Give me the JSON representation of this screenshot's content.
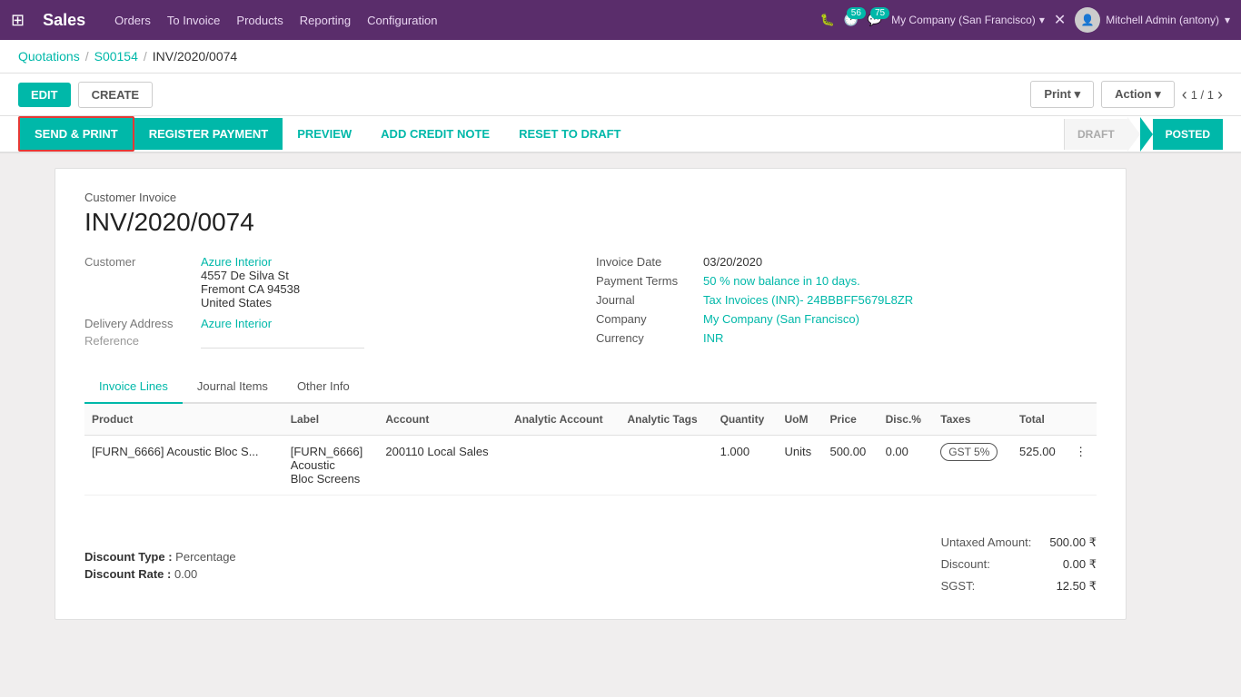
{
  "nav": {
    "brand": "Sales",
    "links": [
      "Orders",
      "To Invoice",
      "Products",
      "Reporting",
      "Configuration"
    ],
    "badge_clock": "56",
    "badge_chat": "75",
    "company": "My Company (San Francisco)",
    "user": "Mitchell Admin (antony)"
  },
  "breadcrumb": {
    "quotations": "Quotations",
    "sale_order": "S00154",
    "invoice": "INV/2020/0074"
  },
  "toolbar": {
    "edit": "EDIT",
    "create": "CREATE",
    "print": "Print",
    "action": "Action",
    "pagination": "1 / 1"
  },
  "secondary_toolbar": {
    "send_print": "SEND & PRINT",
    "register_payment": "REGISTER PAYMENT",
    "preview": "PREVIEW",
    "add_credit_note": "ADD CREDIT NOTE",
    "reset_to_draft": "RESET TO DRAFT",
    "status_draft": "DRAFT",
    "status_posted": "POSTED"
  },
  "invoice": {
    "type": "Customer Invoice",
    "number": "INV/2020/0074",
    "customer_label": "Customer",
    "customer_name": "Azure Interior",
    "customer_address1": "4557 De Silva St",
    "customer_address2": "Fremont CA 94538",
    "customer_address3": "United States",
    "delivery_label": "Delivery Address",
    "delivery_value": "Azure Interior",
    "reference_label": "Reference",
    "invoice_date_label": "Invoice Date",
    "invoice_date_value": "03/20/2020",
    "payment_terms_label": "Payment Terms",
    "payment_terms_value": "50 % now balance in 10 days.",
    "journal_label": "Journal",
    "journal_value": "Tax Invoices (INR)- 24BBBFF5679L8ZR",
    "company_label": "Company",
    "company_value": "My Company (San Francisco)",
    "currency_label": "Currency",
    "currency_value": "INR"
  },
  "tabs": [
    {
      "label": "Invoice Lines",
      "active": true
    },
    {
      "label": "Journal Items",
      "active": false
    },
    {
      "label": "Other Info",
      "active": false
    }
  ],
  "table": {
    "headers": [
      "Product",
      "Label",
      "Account",
      "Analytic Account",
      "Analytic Tags",
      "Quantity",
      "UoM",
      "Price",
      "Disc.%",
      "Taxes",
      "Total"
    ],
    "rows": [
      {
        "product": "[FURN_6666] Acoustic Bloc S...",
        "label_line1": "[FURN_6666]",
        "label_line2": "Acoustic",
        "label_line3": "Bloc Screens",
        "account": "200110 Local Sales",
        "analytic_account": "",
        "analytic_tags": "",
        "quantity": "1.000",
        "uom": "Units",
        "price": "500.00",
        "disc": "0.00",
        "taxes": "GST 5%",
        "total": "525.00"
      }
    ]
  },
  "footer": {
    "discount_type_label": "Discount Type :",
    "discount_type_value": "Percentage",
    "discount_rate_label": "Discount Rate :",
    "discount_rate_value": "0.00",
    "untaxed_label": "Untaxed Amount:",
    "untaxed_value": "500.00 ₹",
    "discount_label": "Discount:",
    "discount_value": "0.00 ₹",
    "sgst_label": "SGST:",
    "sgst_value": "12.50 ₹"
  }
}
